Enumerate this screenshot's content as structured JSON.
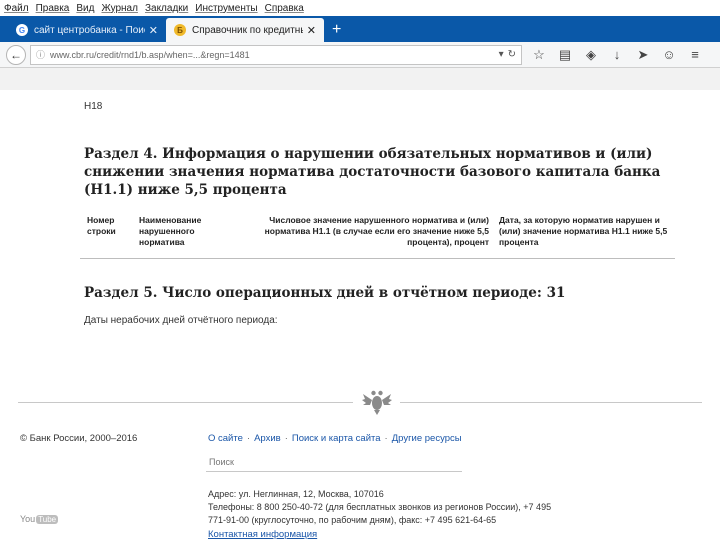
{
  "browser": {
    "menu": [
      "Файл",
      "Правка",
      "Вид",
      "Журнал",
      "Закладки",
      "Инструменты",
      "Справка"
    ],
    "tabs": [
      {
        "label": "сайт центробанка - Поис...",
        "favicon": "google-favicon",
        "active": false
      },
      {
        "label": "Справочник по кредитным...",
        "favicon": "cbr-favicon",
        "active": true
      }
    ],
    "url": "www.cbr.ru/credit/rnd1/b.asp/when=...&regn=1481",
    "colors": {
      "tabbar": "#0a58a8",
      "link": "#1a56a8"
    }
  },
  "page": {
    "form_code": "H18",
    "section4": {
      "title": "Раздел 4. Информация о нарушении обязательных нормативов и (или) снижении значения норматива достаточности базового капитала банка (Н1.1) ниже 5,5 процента",
      "columns": [
        "Номер строки",
        "Наименование нарушенного норматива",
        "Числовое значение нарушенного норматива и (или) норматива Н1.1 (в случае если его значение ниже 5,5 процента), процент",
        "Дата, за которую норматив нарушен и (или) значение норматива Н1.1 ниже 5,5 процента"
      ]
    },
    "section5": {
      "title": "Раздел 5. Число операционных дней в отчётном периоде: 31",
      "non_working_days": "Даты нерабочих дней отчётного периода:"
    }
  },
  "footer": {
    "copyright": "© Банк России, 2000–2016",
    "links": [
      "О сайте",
      "Архив",
      "Поиск и карта сайта",
      "Другие ресурсы"
    ],
    "search_placeholder": "Поиск",
    "address": "Адрес: ул. Неглинная, 12, Москва, 107016",
    "phones": "Телефоны: 8 800 250-40-72 (для бесплатных звонков из регионов России), +7 495 771-91-00 (круглосуточно, по рабочим дням), факс: +7 495 621-64-65",
    "contact_link": "Контактная информация",
    "youtube": {
      "you": "You",
      "tube": "Tube"
    }
  }
}
